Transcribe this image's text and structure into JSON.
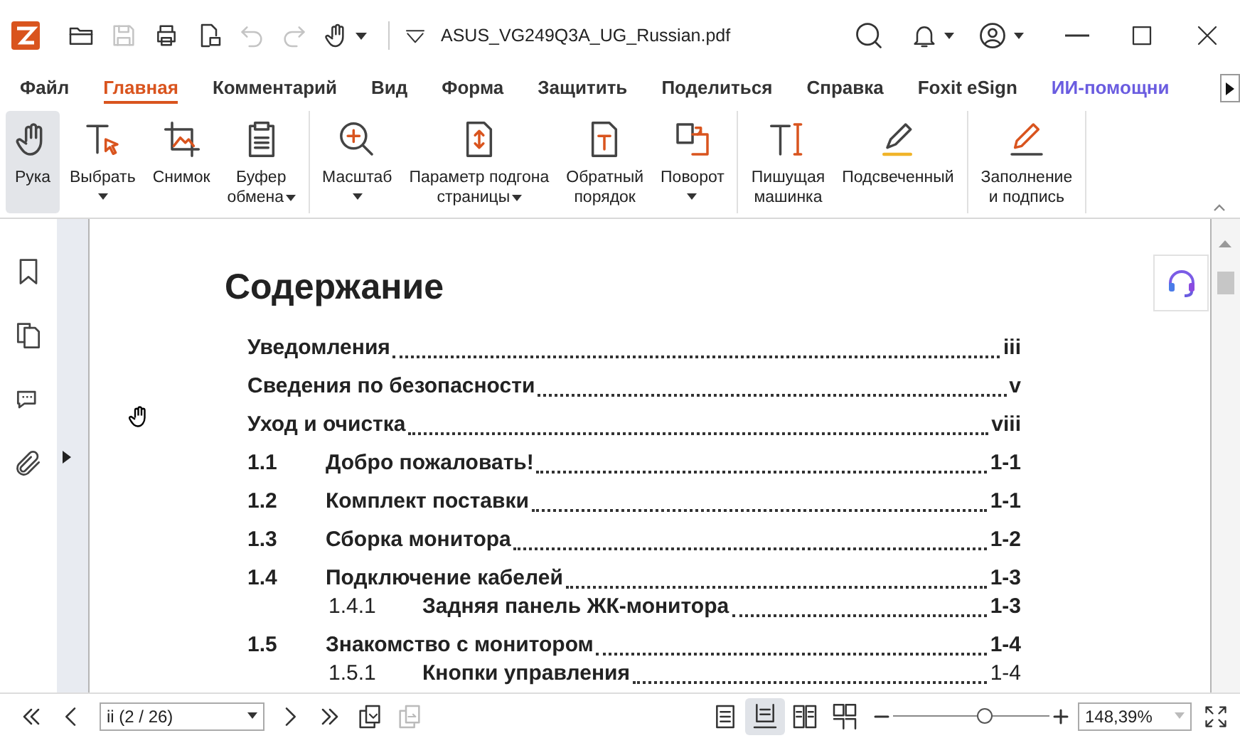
{
  "titlebar": {
    "tools": [
      {
        "kind": "open",
        "disabled": false
      },
      {
        "kind": "save",
        "disabled": true
      },
      {
        "kind": "print",
        "disabled": false
      },
      {
        "kind": "export",
        "disabled": false
      },
      {
        "kind": "undo",
        "disabled": true
      },
      {
        "kind": "redo",
        "disabled": true
      },
      {
        "kind": "hand",
        "disabled": false
      }
    ],
    "filename": "ASUS_VG249Q3A_UG_Russian.pdf"
  },
  "tabs": [
    {
      "label": "Файл",
      "selected": false,
      "kind": "normal"
    },
    {
      "label": "Главная",
      "selected": true,
      "kind": "normal"
    },
    {
      "label": "Комментарий",
      "selected": false,
      "kind": "normal"
    },
    {
      "label": "Вид",
      "selected": false,
      "kind": "normal"
    },
    {
      "label": "Форма",
      "selected": false,
      "kind": "normal"
    },
    {
      "label": "Защитить",
      "selected": false,
      "kind": "normal"
    },
    {
      "label": "Поделиться",
      "selected": false,
      "kind": "normal"
    },
    {
      "label": "Справка",
      "selected": false,
      "kind": "normal"
    },
    {
      "label": "Foxit eSign",
      "selected": false,
      "kind": "normal"
    },
    {
      "label": "ИИ-помощни",
      "selected": false,
      "kind": "ai"
    }
  ],
  "ribbon": {
    "groups": [
      {
        "buttons": [
          {
            "kind": "hand",
            "lines": [
              "Рука"
            ],
            "dropdown": false,
            "selected": true
          },
          {
            "kind": "select",
            "lines": [
              "Выбрать"
            ],
            "dropdown": true,
            "selected": false
          },
          {
            "kind": "snapshot",
            "lines": [
              "Снимок"
            ],
            "dropdown": false,
            "selected": false
          },
          {
            "kind": "clipboard",
            "lines": [
              "Буфер",
              "обмена"
            ],
            "dropdown": true,
            "selected": false
          }
        ]
      },
      {
        "buttons": [
          {
            "kind": "zoom",
            "lines": [
              "Масштаб"
            ],
            "dropdown": true,
            "selected": false
          },
          {
            "kind": "fit",
            "lines": [
              "Параметр подгона",
              "страницы"
            ],
            "dropdown": true,
            "selected": false
          },
          {
            "kind": "reverse",
            "lines": [
              "Обратный",
              "порядок"
            ],
            "dropdown": false,
            "selected": false
          },
          {
            "kind": "rotate",
            "lines": [
              "Поворот"
            ],
            "dropdown": true,
            "selected": false
          }
        ]
      },
      {
        "buttons": [
          {
            "kind": "typewriter",
            "lines": [
              "Пишущая",
              "машинка"
            ],
            "dropdown": false,
            "selected": false
          },
          {
            "kind": "highlight",
            "lines": [
              "Подсвеченный"
            ],
            "dropdown": false,
            "selected": false
          }
        ]
      },
      {
        "buttons": [
          {
            "kind": "fillsign",
            "lines": [
              "Заполнение",
              "и подпись"
            ],
            "dropdown": false,
            "selected": false
          }
        ]
      }
    ]
  },
  "sidebar": {
    "items": [
      {
        "kind": "bookmark"
      },
      {
        "kind": "pages"
      },
      {
        "kind": "comment"
      },
      {
        "kind": "attachment"
      }
    ]
  },
  "document": {
    "heading": "Содержание",
    "toc": [
      {
        "kind": "front",
        "title": "Уведомления",
        "page": "iii",
        "page_bold": true
      },
      {
        "kind": "front",
        "title": "Сведения по безопасности",
        "page": "v",
        "page_bold": true
      },
      {
        "kind": "front",
        "title": "Уход и очистка",
        "page": "viii",
        "page_bold": true
      },
      {
        "kind": "section",
        "number": "1.1",
        "title": "Добро пожаловать!",
        "page": "1-1",
        "page_bold": true
      },
      {
        "kind": "section",
        "number": "1.2",
        "title": "Комплект поставки",
        "page": "1-1",
        "page_bold": true
      },
      {
        "kind": "section",
        "number": "1.3",
        "title": "Сборка монитора",
        "page": "1-2",
        "page_bold": true
      },
      {
        "kind": "section",
        "number": "1.4",
        "title": "Подключение кабелей",
        "page": "1-3",
        "page_bold": true,
        "children": [
          {
            "kind": "sub",
            "number": "1.4.1",
            "title": "Задняя панель ЖК-монитора",
            "page": "1-3",
            "page_bold": true
          }
        ]
      },
      {
        "kind": "section",
        "number": "1.5",
        "title": "Знакомство с монитором",
        "page": "1-4",
        "page_bold": true,
        "children": [
          {
            "kind": "sub",
            "number": "1.5.1",
            "title": "Кнопки управления",
            "page": "1-4",
            "page_bold": false
          }
        ]
      }
    ]
  },
  "statusbar": {
    "nav": [
      {
        "kind": "first",
        "disabled": false
      },
      {
        "kind": "prev",
        "disabled": false
      }
    ],
    "page_field": "ii (2 / 26)",
    "nav2": [
      {
        "kind": "next",
        "disabled": false
      },
      {
        "kind": "last",
        "disabled": false
      },
      {
        "kind": "copy",
        "disabled": false
      },
      {
        "kind": "copy2",
        "disabled": true
      }
    ],
    "view_modes": [
      {
        "kind": "single",
        "selected": false
      },
      {
        "kind": "continuous",
        "selected": true
      },
      {
        "kind": "facing",
        "selected": false
      },
      {
        "kind": "facing-continuous",
        "selected": false
      }
    ],
    "zoom_slider": {
      "level": 0.58
    },
    "zoom_field": "148,39%"
  }
}
